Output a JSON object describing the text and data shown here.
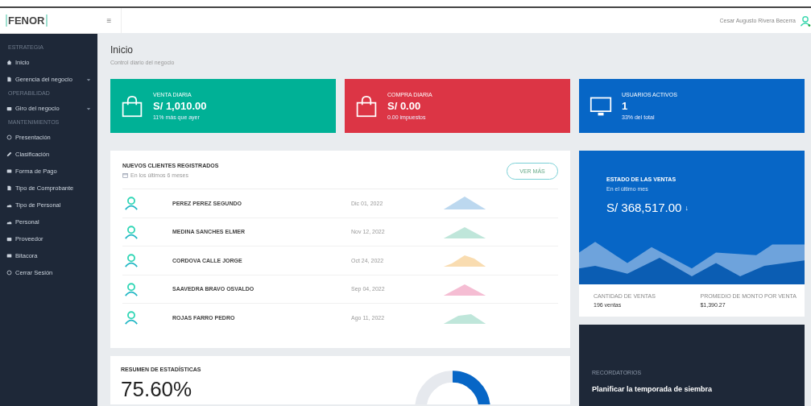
{
  "brand": "FENOR",
  "header": {
    "menu_icon": "≡",
    "user": "Cesar Augusto Rivera Becerra"
  },
  "sidebar": {
    "sections": [
      {
        "title": "ESTRATEGIA",
        "items": [
          {
            "label": "Inicio",
            "kind": "home",
            "expandable": false
          },
          {
            "label": "Gerencia del negocio",
            "kind": "doc",
            "expandable": true
          }
        ]
      },
      {
        "title": "OPERABILIDAD",
        "items": [
          {
            "label": "Giro del negocio",
            "kind": "case",
            "expandable": true
          }
        ]
      },
      {
        "title": "MANTENIMIENTOS",
        "items": [
          {
            "label": "Presentación",
            "kind": "circle",
            "expandable": false
          },
          {
            "label": "Clasificación",
            "kind": "pen",
            "expandable": false
          },
          {
            "label": "Forma de Pago",
            "kind": "card",
            "expandable": false
          },
          {
            "label": "Tipo de Comprobante",
            "kind": "doc",
            "expandable": false
          },
          {
            "label": "Tipo de Personal",
            "kind": "users",
            "expandable": false
          },
          {
            "label": "Personal",
            "kind": "users",
            "expandable": false
          },
          {
            "label": "Proveedor",
            "kind": "case",
            "expandable": false
          },
          {
            "label": "Bitacora",
            "kind": "card",
            "expandable": false
          },
          {
            "label": "Cerrar Sesión",
            "kind": "circle",
            "expandable": false
          }
        ]
      }
    ]
  },
  "page": {
    "title": "Inicio",
    "subtitle": "Control diario del negocio"
  },
  "stat_cards": [
    {
      "kind": "bag",
      "color": "#00b196",
      "label": "VENTA DIARIA",
      "value": "S/ 1,010.00",
      "note": "11% más que ayer"
    },
    {
      "kind": "bag",
      "color": "#dc3545",
      "label": "COMPRA DIARIA",
      "value": "S/ 0.00",
      "note": "0.00 impuestos"
    },
    {
      "kind": "monitor",
      "color": "#0766c6",
      "label": "USUARIOS ACTIVOS",
      "value": "1",
      "note": "33% del total"
    }
  ],
  "clients": {
    "title": "NUEVOS CLIENTES REGISTRADOS",
    "subtitle": "En los últimos 6 meses",
    "button": "VER MÁS",
    "rows": [
      {
        "name": "PEREZ PEREZ SEGUNDO",
        "date": "Dic 01, 2022",
        "color": "#bcd8ef"
      },
      {
        "name": "MEDINA SANCHES ELMER",
        "date": "Nov 12, 2022",
        "color": "#bfe6da"
      },
      {
        "name": "CORDOVA CALLE JORGE",
        "date": "Oct 24, 2022",
        "color": "#f9dcb0"
      },
      {
        "name": "SAAVEDRA BRAVO OSVALDO",
        "date": "Sep 04, 2022",
        "color": "#f5bdd3"
      },
      {
        "name": "ROJAS FARRO PEDRO",
        "date": "Ago 11, 2022",
        "color": "#bfe6da"
      }
    ]
  },
  "sales": {
    "title": "ESTADO DE LAS VENTAS",
    "subtitle": "En el último mes",
    "value": "S/ 368,517.00",
    "trend_icon": "↓",
    "stats": [
      {
        "label": "CANTIDAD DE VENTAS",
        "value": "196 ventas"
      },
      {
        "label": "PROMEDIO DE MONTO POR VENTA",
        "value": "$1,390.27"
      }
    ]
  },
  "summary": {
    "title": "RESUMEN DE ESTADÍSTICAS",
    "value": "75.60%"
  },
  "reminders": {
    "title": "RECORDATORIOS",
    "item": "Planificar la temporada de siembra"
  }
}
